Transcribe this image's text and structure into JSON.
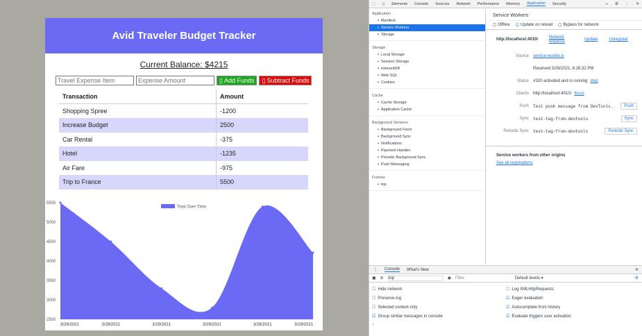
{
  "app": {
    "title": "Avid Traveler Budget Tracker",
    "balance": "Current Balance: $4215",
    "item_placeholder": "Travel Expense Item",
    "amount_placeholder": "Expense Amount",
    "add_label": "Add Funds",
    "sub_label": "Subtract Funds",
    "headers": [
      "Transaction",
      "Amount"
    ],
    "rows": [
      [
        "Shopping Spree",
        "-1200"
      ],
      [
        "Increase Budget",
        "2500"
      ],
      [
        "Car Rental",
        "-375"
      ],
      [
        "Hotel",
        "-1235"
      ],
      [
        "Air Fare",
        "-975"
      ],
      [
        "Trip to France",
        "5500"
      ]
    ],
    "colors": {
      "header": "#6a6af5",
      "add": "#1fa51f",
      "subtract": "#dd0c0c",
      "alt_row": "#d7d7fb"
    }
  },
  "chart_data": {
    "type": "area",
    "series": [
      {
        "name": "Total Over Time",
        "values": [
          5500,
          4500,
          3300,
          2800,
          5400,
          4215
        ]
      }
    ],
    "x": [
      "3/29/2021",
      "3/29/2021",
      "3/29/2021",
      "3/29/2021",
      "3/29/2021",
      "3/29/2021"
    ],
    "yticks": [
      5500,
      5000,
      4500,
      4000,
      3500,
      3000,
      2500
    ],
    "ylim": [
      2500,
      5500
    ],
    "legend": "top",
    "color": "#6a6af5"
  },
  "devtools": {
    "tabs": [
      "Elements",
      "Console",
      "Sources",
      "Network",
      "Performance",
      "Memory",
      "Application",
      "Security"
    ],
    "sidebar": {
      "app_title": "Application",
      "app_items": [
        "Manifest",
        "Service Workers",
        "Storage"
      ],
      "storage_title": "Storage",
      "storage_items": [
        "Local Storage",
        "Session Storage",
        "IndexedDB",
        "Web SQL",
        "Cookies"
      ],
      "cache_title": "Cache",
      "cache_items": [
        "Cache Storage",
        "Application Cache"
      ],
      "bg_title": "Background Services",
      "bg_items": [
        "Background Fetch",
        "Background Sync",
        "Notifications",
        "Payment Handler",
        "Periodic Background Sync",
        "Push Messaging"
      ],
      "frames_title": "Frames",
      "frames_items": [
        "top"
      ]
    },
    "sw": {
      "title": "Service Workers",
      "offline": "Offline",
      "update_reload": "Update on reload",
      "bypass": "Bypass for network",
      "origin": "http://localhost:4010/",
      "network_requests": "Network requests",
      "update": "Update",
      "unregister": "Unregister",
      "source_label": "Source",
      "source": "service-worker.js",
      "received": "Received 3/29/2021, 6:28:32 PM",
      "status_label": "Status",
      "status": "#320 activated and is running",
      "stop": "stop",
      "clients_label": "Clients",
      "clients": "http://localhost:4010/",
      "focus": "focus",
      "push_label": "Push",
      "push_value": "Test push message from DevTools.",
      "push_btn": "Push",
      "sync_label": "Sync",
      "sync_value": "test-tag-from-devtools",
      "sync_btn": "Sync",
      "periodic_label": "Periodic Sync",
      "periodic_value": "test-tag-from-devtools",
      "periodic_btn": "Periodic Sync",
      "other_origins": "Service workers from other origins",
      "see_all": "See all registrations"
    },
    "console": {
      "tabs": [
        "Console",
        "What's New"
      ],
      "context": "top",
      "filter": "Filter",
      "levels": "Default levels ▾",
      "left_opts": [
        "Hide network",
        "Preserve log",
        "Selected context only",
        "Group similar messages in console"
      ],
      "right_opts": [
        "Log XMLHttpRequests",
        "Eager evaluation",
        "Autocomplete from history",
        "Evaluate triggers user activation"
      ],
      "left_checked": [
        false,
        false,
        false,
        true
      ],
      "right_checked": [
        false,
        true,
        true,
        true
      ],
      "prompt": "›"
    }
  }
}
